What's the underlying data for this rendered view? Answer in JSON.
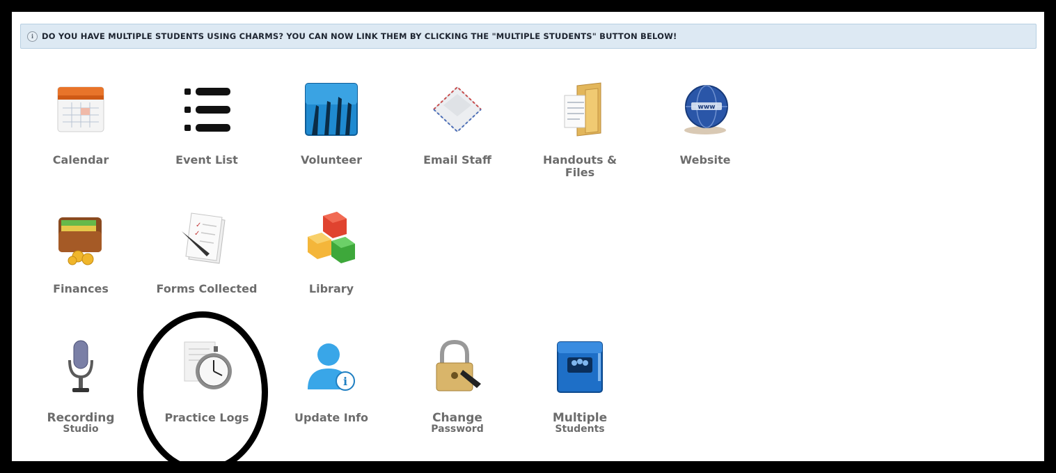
{
  "notice": {
    "icon": "info-icon",
    "text": "DO YOU HAVE MULTIPLE STUDENTS USING CHARMS? YOU CAN NOW LINK THEM BY CLICKING THE \"MULTIPLE STUDENTS\" BUTTON BELOW!"
  },
  "tiles": [
    {
      "label": "Calendar",
      "icon": "calendar-icon"
    },
    {
      "label": "Event List",
      "icon": "list-icon"
    },
    {
      "label": "Volunteer",
      "icon": "volunteer-hands-icon"
    },
    {
      "label": "Email Staff",
      "icon": "envelope-icon"
    },
    {
      "label": "Handouts & Files",
      "icon": "folder-icon"
    },
    {
      "label": "Website",
      "icon": "globe-icon"
    },
    {
      "label": "Finances",
      "icon": "wallet-icon"
    },
    {
      "label": "Forms Collected",
      "icon": "forms-icon"
    },
    {
      "label": "Library",
      "icon": "blocks-icon"
    },
    {
      "label": "Recording",
      "sub": "Studio",
      "icon": "microphone-icon"
    },
    {
      "label": "Practice Logs",
      "icon": "stopwatch-icon"
    },
    {
      "label": "Update Info",
      "icon": "user-info-icon"
    },
    {
      "label": "Change",
      "sub": "Password",
      "icon": "padlock-icon"
    },
    {
      "label": "Multiple",
      "sub": "Students",
      "icon": "multiple-students-icon"
    }
  ],
  "highlight": {
    "target": "Practice Logs"
  }
}
